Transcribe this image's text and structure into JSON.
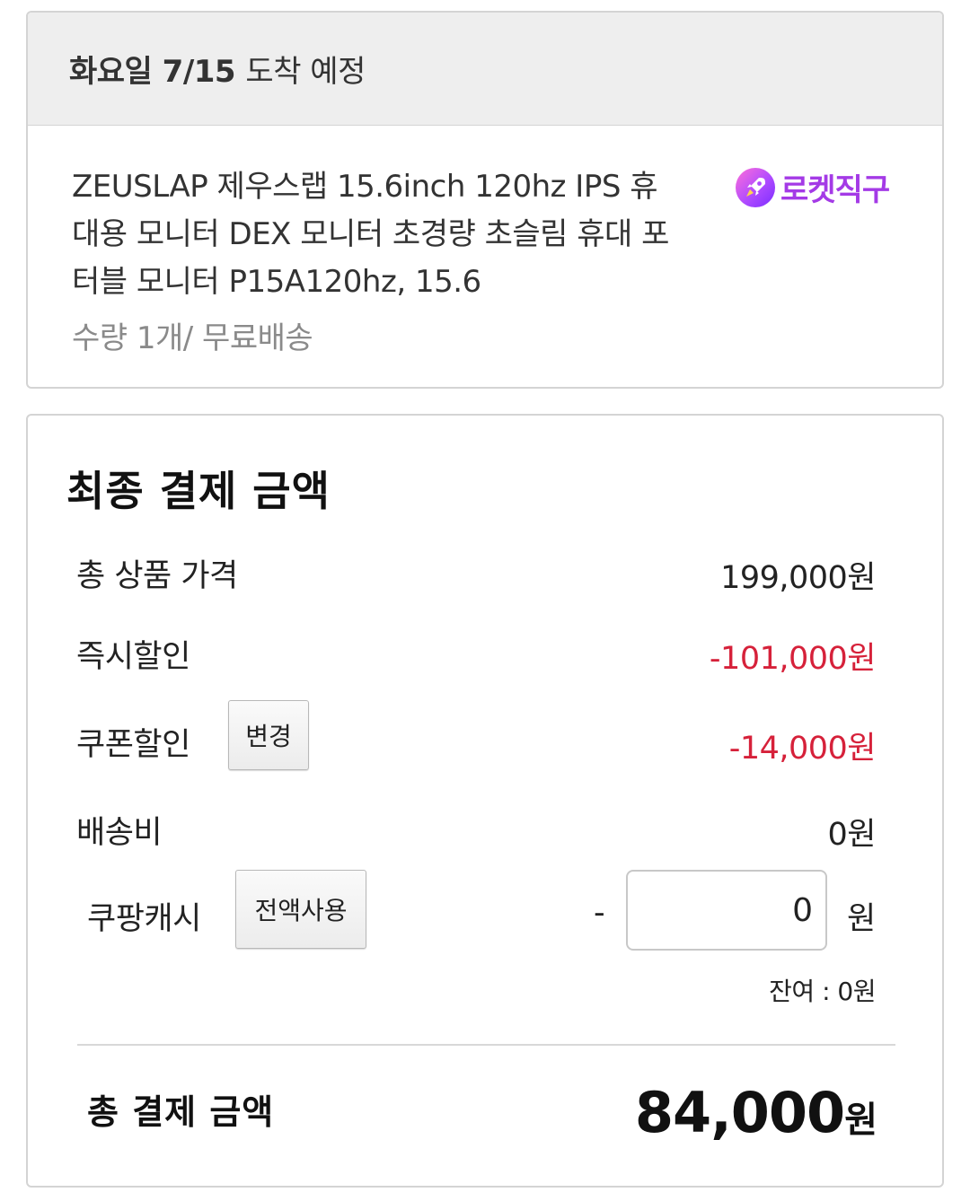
{
  "delivery": {
    "date_bold": "화요일 7/15",
    "date_rest": "도착 예정",
    "product_title": "ZEUSLAP 제우스랩 15.6inch 120hz IPS 휴대용 모니터 DEX 모니터 초경량 초슬림 휴대 포터블 모니터 P15A120hz, 15.6",
    "product_meta": "수량 1개/ 무료배송",
    "badge": {
      "icon": "rocket-icon",
      "label": "로켓직구",
      "color": "#a43ae6"
    }
  },
  "payment": {
    "title": "최종 결제 금액",
    "rows": {
      "subtotal": {
        "label": "총 상품 가격",
        "value": "199,000원"
      },
      "instant_discount": {
        "label": "즉시할인",
        "value": "-101,000원"
      },
      "coupon_discount": {
        "label": "쿠폰할인",
        "button": "변경",
        "value": "-14,000원"
      },
      "shipping": {
        "label": "배송비",
        "value": "0원"
      }
    },
    "cash": {
      "label": "쿠팡캐시",
      "button": "전액사용",
      "minus": "-",
      "input_value": "0",
      "unit": "원",
      "balance": "잔여 : 0원"
    },
    "total": {
      "label": "총 결제 금액",
      "amount": "84,000",
      "unit": "원"
    },
    "discount_color": "#d6213a"
  }
}
